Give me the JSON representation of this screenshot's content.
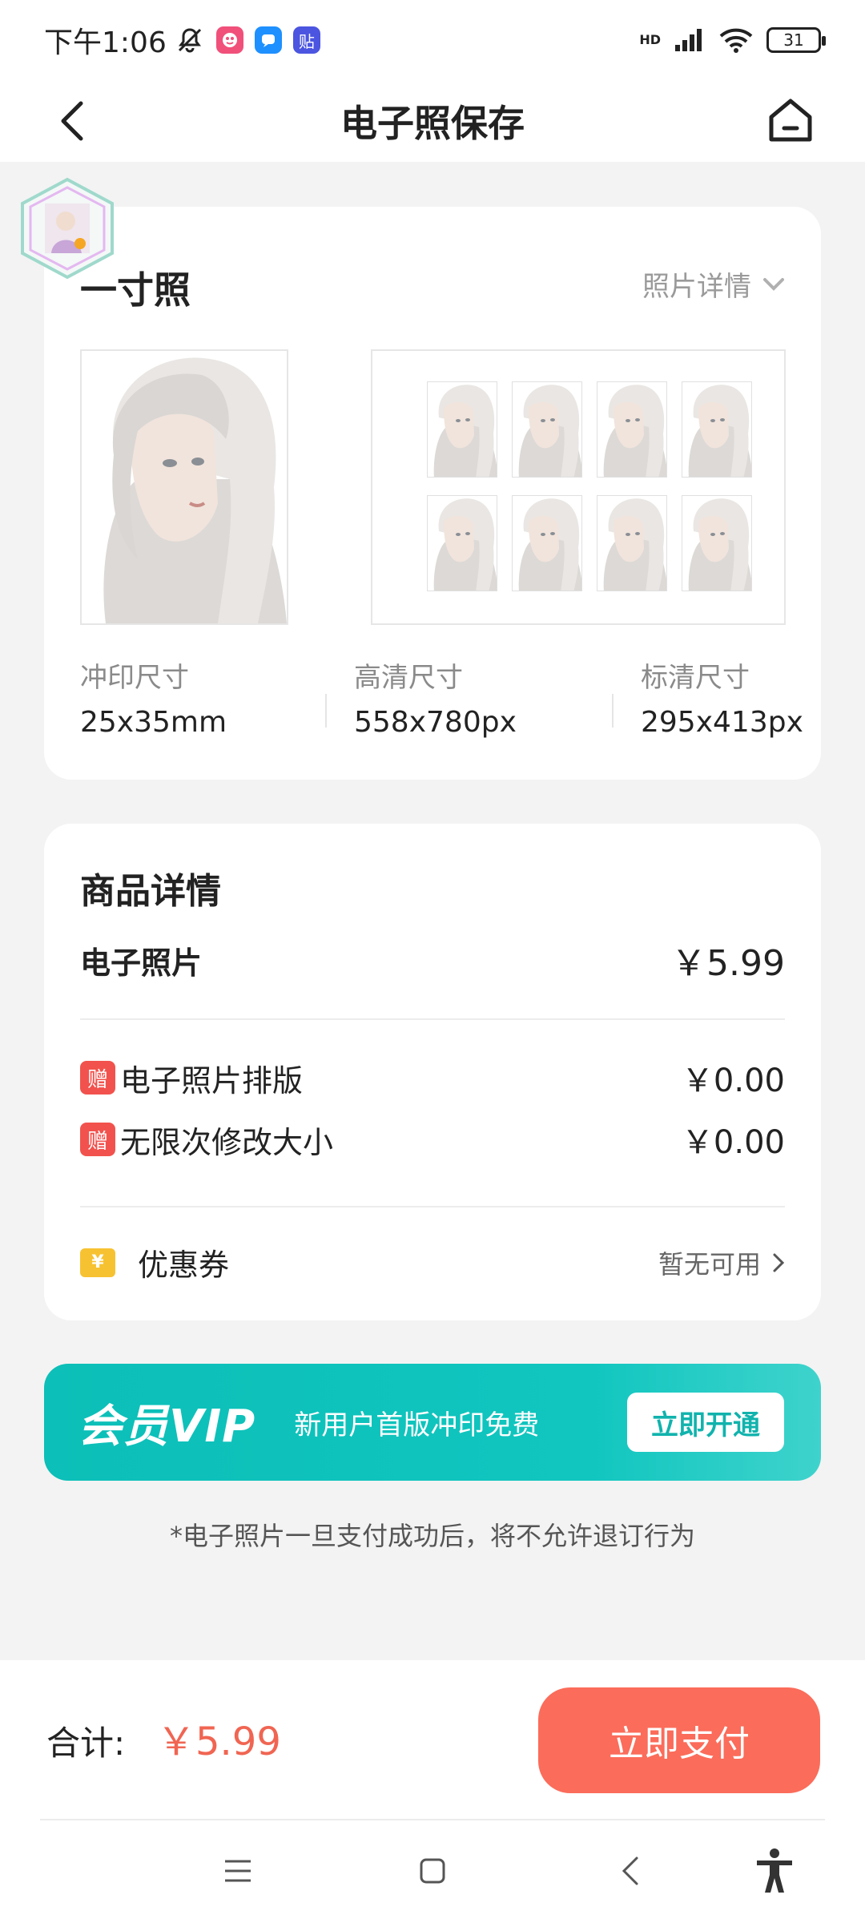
{
  "status_bar": {
    "time": "下午1:06",
    "hd": "HD",
    "battery": "31",
    "app_icons": [
      {
        "icon": "app-red-icon",
        "glyph": "",
        "color": "#f0507a"
      },
      {
        "icon": "app-blue-icon",
        "glyph": "",
        "color": "#1e90ff"
      },
      {
        "icon": "tieba-icon",
        "glyph": "贴",
        "color": "#4b55e0"
      }
    ]
  },
  "nav": {
    "title": "电子照保存"
  },
  "photo_card": {
    "title": "一寸照",
    "detail_link": "照片详情",
    "sizes": [
      {
        "label": "冲印尺寸",
        "value": "25x35mm"
      },
      {
        "label": "高清尺寸",
        "value": "558x780px"
      },
      {
        "label": "标清尺寸",
        "value": "295x413px"
      }
    ]
  },
  "product_card": {
    "title": "商品详情",
    "main_item": {
      "label": "电子照片",
      "price": "￥5.99"
    },
    "gifts": [
      {
        "badge": "赠",
        "label": "电子照片排版",
        "price": "￥0.00"
      },
      {
        "badge": "赠",
        "label": "无限次修改大小",
        "price": "￥0.00"
      }
    ],
    "coupon": {
      "icon": "¥",
      "label": "优惠券",
      "status": "暂无可用"
    }
  },
  "vip_banner": {
    "logo": "会员VIP",
    "text": "新用户首版冲印免费",
    "button": "立即开通"
  },
  "notice": "*电子照片一旦支付成功后，将不允许退订行为",
  "pay_bar": {
    "total_label": "合计:",
    "total_price": "￥5.99",
    "pay_button": "立即支付"
  },
  "colors": {
    "accent_red": "#fb6c5a",
    "price_red": "#f06552",
    "vip_teal": "#10c6bf",
    "gift_red": "#f2524d",
    "coupon_yellow": "#f7c231"
  }
}
